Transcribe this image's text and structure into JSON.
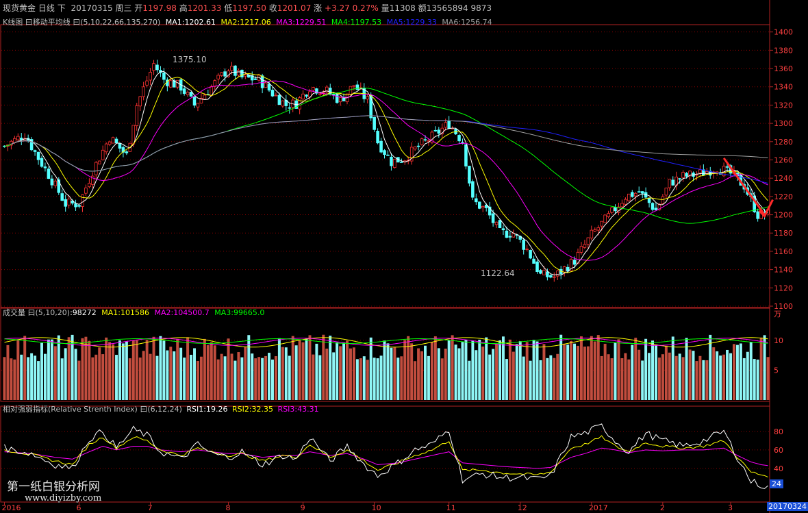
{
  "header": {
    "instrument": "现货黄金",
    "period": "日线",
    "mode": "下",
    "date": "20170315",
    "weekday": "周三",
    "open_label": "开",
    "open": "1197.98",
    "high_label": "高",
    "high": "1201.33",
    "low_label": "低",
    "low": "1197.50",
    "close_label": "收",
    "close": "1201.07",
    "chg_label": "涨",
    "chg": "+3.27",
    "chg_pct": "0.27%",
    "vol_label": "量",
    "vol": "11308",
    "amt_label": "额",
    "amt": "13565894",
    "extra": "9873"
  },
  "ma_legend": {
    "title": "K线图 曰移动平均线 曰(5,10,22,66,135,270)",
    "items": [
      {
        "text": "MA1:1202.61",
        "color": "#ffffff"
      },
      {
        "text": "MA2:1217.06",
        "color": "#ffff00"
      },
      {
        "text": "MA3:1229.51",
        "color": "#ff00ff"
      },
      {
        "text": "MA4:1197.53",
        "color": "#00ff00"
      },
      {
        "text": "MA5:1229.33",
        "color": "#2020ff"
      },
      {
        "text": "MA6:1256.74",
        "color": "#a0a0a0"
      }
    ]
  },
  "annotations": {
    "high_label": "1375.10",
    "low_label": "1122.64"
  },
  "vol_legend": {
    "title": "成交量 曰(5,10,20)",
    "items": [
      {
        "text": ":98272",
        "color": "#ffffff"
      },
      {
        "text": "MA1:101586",
        "color": "#ffff00"
      },
      {
        "text": "MA2:104500.7",
        "color": "#ff00ff"
      },
      {
        "text": "MA3:99665.0",
        "color": "#00ff00"
      }
    ],
    "unit": "万"
  },
  "rsi_legend": {
    "title": "相对强弱指标(Relative Strenth Index) 曰(6,12,24)",
    "items": [
      {
        "text": "RSI1:19.26",
        "color": "#ffffff"
      },
      {
        "text": "RSI2:32.35",
        "color": "#ffff00"
      },
      {
        "text": "RSI3:43.31",
        "color": "#ff00ff"
      }
    ]
  },
  "watermark": {
    "line1": "第一纸白银分析网",
    "line2": "www.diyizby.com"
  },
  "rsi_current_badge": "24",
  "date_badge": "20170324",
  "colors": {
    "up": "#ff3333",
    "down": "#54ffff",
    "grid": "#8b0000",
    "axis": "#b22222",
    "vol_up": "#c24d3e",
    "vol_down": "#8ff6f6",
    "arrow": "#ff2a2a"
  },
  "chart_data": {
    "type": "candlestick",
    "price_axis": {
      "ticks": [
        1400,
        1380,
        1360,
        1340,
        1320,
        1300,
        1280,
        1260,
        1240,
        1220,
        1200,
        1180,
        1160,
        1140,
        1120,
        1100
      ],
      "ylim": [
        1100,
        1405
      ]
    },
    "volume_axis": {
      "ticks": [
        10,
        5
      ],
      "ylim": [
        0,
        14
      ],
      "unit": "万"
    },
    "rsi_axis": {
      "ticks": [
        80,
        60,
        40
      ],
      "ylim": [
        5,
        100
      ]
    },
    "x_ticks": [
      "2016",
      "6",
      "7",
      "8",
      "9",
      "10",
      "11",
      "12",
      "2017",
      "2",
      "3"
    ],
    "x_tick_index": [
      0,
      22,
      43,
      66,
      88,
      109,
      131,
      152,
      173,
      194,
      214
    ],
    "n_bars": 226,
    "price_path": [
      [
        0,
        1275
      ],
      [
        6,
        1288
      ],
      [
        10,
        1262
      ],
      [
        14,
        1238
      ],
      [
        18,
        1212
      ],
      [
        22,
        1212
      ],
      [
        26,
        1248
      ],
      [
        31,
        1285
      ],
      [
        36,
        1265
      ],
      [
        39,
        1320
      ],
      [
        44,
        1365
      ],
      [
        47,
        1348
      ],
      [
        52,
        1340
      ],
      [
        56,
        1320
      ],
      [
        61,
        1340
      ],
      [
        66,
        1360
      ],
      [
        70,
        1350
      ],
      [
        75,
        1348
      ],
      [
        79,
        1333
      ],
      [
        83,
        1320
      ],
      [
        86,
        1322
      ],
      [
        90,
        1340
      ],
      [
        95,
        1335
      ],
      [
        99,
        1325
      ],
      [
        103,
        1342
      ],
      [
        107,
        1325
      ],
      [
        110,
        1280
      ],
      [
        114,
        1258
      ],
      [
        118,
        1262
      ],
      [
        122,
        1275
      ],
      [
        126,
        1285
      ],
      [
        131,
        1300
      ],
      [
        135,
        1280
      ],
      [
        138,
        1215
      ],
      [
        142,
        1205
      ],
      [
        146,
        1180
      ],
      [
        150,
        1180
      ],
      [
        154,
        1162
      ],
      [
        158,
        1134
      ],
      [
        162,
        1132
      ],
      [
        168,
        1150
      ],
      [
        173,
        1178
      ],
      [
        178,
        1198
      ],
      [
        183,
        1220
      ],
      [
        187,
        1225
      ],
      [
        192,
        1205
      ],
      [
        196,
        1235
      ],
      [
        200,
        1242
      ],
      [
        205,
        1245
      ],
      [
        210,
        1252
      ],
      [
        214,
        1245
      ],
      [
        218,
        1232
      ],
      [
        222,
        1200
      ],
      [
        225,
        1201
      ]
    ],
    "rsi_path": {
      "RSI1": [
        [
          0,
          62
        ],
        [
          8,
          56
        ],
        [
          15,
          44
        ],
        [
          20,
          40
        ],
        [
          25,
          72
        ],
        [
          29,
          80
        ],
        [
          33,
          62
        ],
        [
          38,
          82
        ],
        [
          42,
          76
        ],
        [
          46,
          58
        ],
        [
          52,
          50
        ],
        [
          57,
          66
        ],
        [
          61,
          56
        ],
        [
          66,
          52
        ],
        [
          70,
          58
        ],
        [
          76,
          44
        ],
        [
          82,
          54
        ],
        [
          86,
          50
        ],
        [
          90,
          74
        ],
        [
          96,
          48
        ],
        [
          101,
          64
        ],
        [
          106,
          44
        ],
        [
          110,
          32
        ],
        [
          116,
          46
        ],
        [
          121,
          60
        ],
        [
          126,
          66
        ],
        [
          131,
          82
        ],
        [
          135,
          28
        ],
        [
          141,
          34
        ],
        [
          147,
          30
        ],
        [
          152,
          30
        ],
        [
          157,
          28
        ],
        [
          161,
          32
        ],
        [
          167,
          74
        ],
        [
          171,
          78
        ],
        [
          176,
          86
        ],
        [
          180,
          70
        ],
        [
          184,
          58
        ],
        [
          189,
          78
        ],
        [
          194,
          70
        ],
        [
          200,
          64
        ],
        [
          206,
          70
        ],
        [
          212,
          80
        ],
        [
          216,
          52
        ],
        [
          220,
          26
        ],
        [
          223,
          22
        ],
        [
          225,
          19
        ]
      ],
      "RSI2": [
        [
          0,
          60
        ],
        [
          8,
          55
        ],
        [
          15,
          48
        ],
        [
          20,
          44
        ],
        [
          25,
          66
        ],
        [
          29,
          74
        ],
        [
          33,
          62
        ],
        [
          38,
          74
        ],
        [
          42,
          70
        ],
        [
          46,
          60
        ],
        [
          52,
          54
        ],
        [
          57,
          62
        ],
        [
          61,
          58
        ],
        [
          66,
          54
        ],
        [
          70,
          56
        ],
        [
          76,
          48
        ],
        [
          82,
          54
        ],
        [
          86,
          52
        ],
        [
          90,
          66
        ],
        [
          96,
          52
        ],
        [
          101,
          60
        ],
        [
          106,
          48
        ],
        [
          110,
          38
        ],
        [
          116,
          46
        ],
        [
          121,
          54
        ],
        [
          126,
          60
        ],
        [
          131,
          70
        ],
        [
          135,
          38
        ],
        [
          141,
          38
        ],
        [
          147,
          35
        ],
        [
          152,
          34
        ],
        [
          157,
          33
        ],
        [
          161,
          36
        ],
        [
          167,
          62
        ],
        [
          171,
          66
        ],
        [
          176,
          74
        ],
        [
          180,
          64
        ],
        [
          184,
          58
        ],
        [
          189,
          68
        ],
        [
          194,
          64
        ],
        [
          200,
          62
        ],
        [
          206,
          64
        ],
        [
          212,
          70
        ],
        [
          216,
          52
        ],
        [
          220,
          36
        ],
        [
          223,
          33
        ],
        [
          225,
          32
        ]
      ],
      "RSI3": [
        [
          0,
          58
        ],
        [
          8,
          56
        ],
        [
          15,
          52
        ],
        [
          20,
          50
        ],
        [
          25,
          58
        ],
        [
          29,
          64
        ],
        [
          33,
          60
        ],
        [
          38,
          64
        ],
        [
          42,
          64
        ],
        [
          46,
          60
        ],
        [
          52,
          58
        ],
        [
          57,
          60
        ],
        [
          61,
          58
        ],
        [
          66,
          56
        ],
        [
          70,
          56
        ],
        [
          76,
          52
        ],
        [
          82,
          54
        ],
        [
          86,
          54
        ],
        [
          90,
          58
        ],
        [
          96,
          54
        ],
        [
          101,
          56
        ],
        [
          106,
          50
        ],
        [
          110,
          44
        ],
        [
          116,
          46
        ],
        [
          121,
          50
        ],
        [
          126,
          54
        ],
        [
          131,
          58
        ],
        [
          135,
          46
        ],
        [
          141,
          44
        ],
        [
          147,
          42
        ],
        [
          152,
          41
        ],
        [
          157,
          40
        ],
        [
          161,
          41
        ],
        [
          167,
          52
        ],
        [
          171,
          56
        ],
        [
          176,
          62
        ],
        [
          180,
          60
        ],
        [
          184,
          57
        ],
        [
          189,
          60
        ],
        [
          194,
          59
        ],
        [
          200,
          60
        ],
        [
          206,
          60
        ],
        [
          212,
          62
        ],
        [
          216,
          54
        ],
        [
          220,
          47
        ],
        [
          223,
          44
        ],
        [
          225,
          43
        ]
      ]
    }
  }
}
